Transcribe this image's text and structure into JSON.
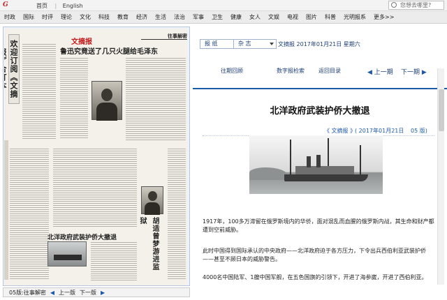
{
  "topbar": {
    "logo": "G",
    "links": [
      "首页",
      "English"
    ],
    "search_placeholder": "您想去哪里?"
  },
  "nav": {
    "items": [
      "时政",
      "国际",
      "时评",
      "理论",
      "文化",
      "科技",
      "教育",
      "经济",
      "生活",
      "法治",
      "军事",
      "卫生",
      "健康",
      "女人",
      "文娱",
      "电视",
      "图片",
      "科普",
      "光明报系",
      "更多>>"
    ]
  },
  "paper": {
    "masthead": "欢迎订阅《文摘报》合订本",
    "title": "文摘报",
    "column": "往事解密",
    "headline1": "鲁迅究竟送了几只火腿给毛泽东",
    "headline2": "北洋政府武装护侨大撤退",
    "vertical_headline": "胡适曾梦游进监狱"
  },
  "bottom_nav": {
    "edition": "05版:往事解密",
    "prev": "上一版",
    "next": "下一版"
  },
  "selectors": {
    "newspaper": "报 纸",
    "magazine": "杂 志",
    "date_text": "文摘报 2017年01月21日 星期六"
  },
  "actions": {
    "past": "往期回顾",
    "search": "数字报检索",
    "back": "返回目录",
    "prev": "上一期",
    "next": "下一期"
  },
  "article": {
    "title": "北洋政府武装护侨大撤退",
    "source": "《 文摘报 》",
    "date": "( 2017年01月21日",
    "page": "05 版)",
    "paragraphs": [
      "1917年，100多万滞留在俄罗斯境内的华侨，面对混乱而血腥的俄罗斯内战，其生命和财产都遭到空前威胁。",
      "此时中国得到国际承认的中央政府——北洋政府迫于各方压力，下令出兵西伯利亚武装护侨——甚至不顾日本的威胁警告。",
      "4000名中国陆军、1艘中国军舰，在五色国旗的引领下，开进了海参崴，开进了西伯利亚。"
    ]
  },
  "colors": {
    "accent": "#1b5aa6",
    "logo": "#c41b1b"
  }
}
